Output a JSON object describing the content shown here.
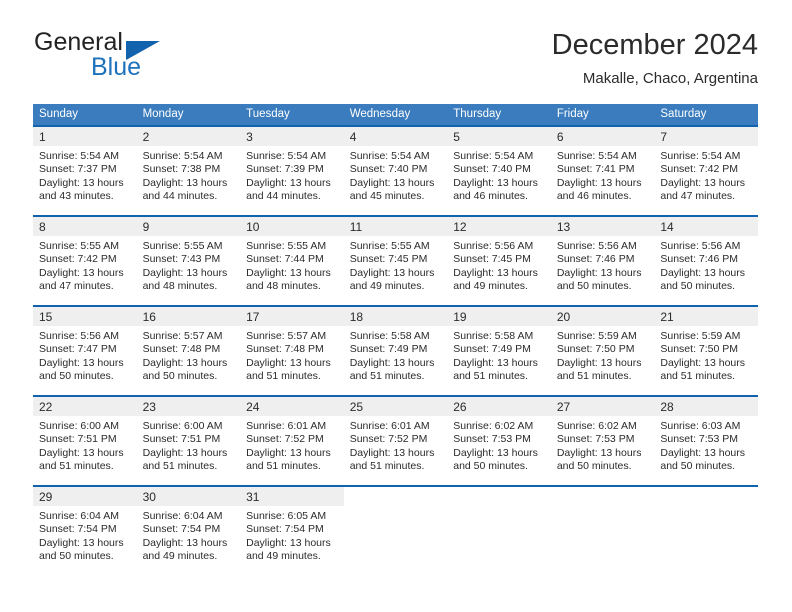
{
  "brand": {
    "name_top": "General",
    "name_bottom": "Blue",
    "accent_color": "#1263ad",
    "text_color": "#232323"
  },
  "header": {
    "title": "December 2024",
    "location": "Makalle, Chaco, Argentina"
  },
  "calendar": {
    "header_bg": "#3a7cbe",
    "row_divider_color": "#1263ad",
    "daynum_band_color": "#efefef",
    "weekday_headers": [
      "Sunday",
      "Monday",
      "Tuesday",
      "Wednesday",
      "Thursday",
      "Friday",
      "Saturday"
    ],
    "weeks": [
      [
        {
          "day": "1",
          "sunrise": "Sunrise: 5:54 AM",
          "sunset": "Sunset: 7:37 PM",
          "daylight_line1": "Daylight: 13 hours",
          "daylight_line2": "and 43 minutes."
        },
        {
          "day": "2",
          "sunrise": "Sunrise: 5:54 AM",
          "sunset": "Sunset: 7:38 PM",
          "daylight_line1": "Daylight: 13 hours",
          "daylight_line2": "and 44 minutes."
        },
        {
          "day": "3",
          "sunrise": "Sunrise: 5:54 AM",
          "sunset": "Sunset: 7:39 PM",
          "daylight_line1": "Daylight: 13 hours",
          "daylight_line2": "and 44 minutes."
        },
        {
          "day": "4",
          "sunrise": "Sunrise: 5:54 AM",
          "sunset": "Sunset: 7:40 PM",
          "daylight_line1": "Daylight: 13 hours",
          "daylight_line2": "and 45 minutes."
        },
        {
          "day": "5",
          "sunrise": "Sunrise: 5:54 AM",
          "sunset": "Sunset: 7:40 PM",
          "daylight_line1": "Daylight: 13 hours",
          "daylight_line2": "and 46 minutes."
        },
        {
          "day": "6",
          "sunrise": "Sunrise: 5:54 AM",
          "sunset": "Sunset: 7:41 PM",
          "daylight_line1": "Daylight: 13 hours",
          "daylight_line2": "and 46 minutes."
        },
        {
          "day": "7",
          "sunrise": "Sunrise: 5:54 AM",
          "sunset": "Sunset: 7:42 PM",
          "daylight_line1": "Daylight: 13 hours",
          "daylight_line2": "and 47 minutes."
        }
      ],
      [
        {
          "day": "8",
          "sunrise": "Sunrise: 5:55 AM",
          "sunset": "Sunset: 7:42 PM",
          "daylight_line1": "Daylight: 13 hours",
          "daylight_line2": "and 47 minutes."
        },
        {
          "day": "9",
          "sunrise": "Sunrise: 5:55 AM",
          "sunset": "Sunset: 7:43 PM",
          "daylight_line1": "Daylight: 13 hours",
          "daylight_line2": "and 48 minutes."
        },
        {
          "day": "10",
          "sunrise": "Sunrise: 5:55 AM",
          "sunset": "Sunset: 7:44 PM",
          "daylight_line1": "Daylight: 13 hours",
          "daylight_line2": "and 48 minutes."
        },
        {
          "day": "11",
          "sunrise": "Sunrise: 5:55 AM",
          "sunset": "Sunset: 7:45 PM",
          "daylight_line1": "Daylight: 13 hours",
          "daylight_line2": "and 49 minutes."
        },
        {
          "day": "12",
          "sunrise": "Sunrise: 5:56 AM",
          "sunset": "Sunset: 7:45 PM",
          "daylight_line1": "Daylight: 13 hours",
          "daylight_line2": "and 49 minutes."
        },
        {
          "day": "13",
          "sunrise": "Sunrise: 5:56 AM",
          "sunset": "Sunset: 7:46 PM",
          "daylight_line1": "Daylight: 13 hours",
          "daylight_line2": "and 50 minutes."
        },
        {
          "day": "14",
          "sunrise": "Sunrise: 5:56 AM",
          "sunset": "Sunset: 7:46 PM",
          "daylight_line1": "Daylight: 13 hours",
          "daylight_line2": "and 50 minutes."
        }
      ],
      [
        {
          "day": "15",
          "sunrise": "Sunrise: 5:56 AM",
          "sunset": "Sunset: 7:47 PM",
          "daylight_line1": "Daylight: 13 hours",
          "daylight_line2": "and 50 minutes."
        },
        {
          "day": "16",
          "sunrise": "Sunrise: 5:57 AM",
          "sunset": "Sunset: 7:48 PM",
          "daylight_line1": "Daylight: 13 hours",
          "daylight_line2": "and 50 minutes."
        },
        {
          "day": "17",
          "sunrise": "Sunrise: 5:57 AM",
          "sunset": "Sunset: 7:48 PM",
          "daylight_line1": "Daylight: 13 hours",
          "daylight_line2": "and 51 minutes."
        },
        {
          "day": "18",
          "sunrise": "Sunrise: 5:58 AM",
          "sunset": "Sunset: 7:49 PM",
          "daylight_line1": "Daylight: 13 hours",
          "daylight_line2": "and 51 minutes."
        },
        {
          "day": "19",
          "sunrise": "Sunrise: 5:58 AM",
          "sunset": "Sunset: 7:49 PM",
          "daylight_line1": "Daylight: 13 hours",
          "daylight_line2": "and 51 minutes."
        },
        {
          "day": "20",
          "sunrise": "Sunrise: 5:59 AM",
          "sunset": "Sunset: 7:50 PM",
          "daylight_line1": "Daylight: 13 hours",
          "daylight_line2": "and 51 minutes."
        },
        {
          "day": "21",
          "sunrise": "Sunrise: 5:59 AM",
          "sunset": "Sunset: 7:50 PM",
          "daylight_line1": "Daylight: 13 hours",
          "daylight_line2": "and 51 minutes."
        }
      ],
      [
        {
          "day": "22",
          "sunrise": "Sunrise: 6:00 AM",
          "sunset": "Sunset: 7:51 PM",
          "daylight_line1": "Daylight: 13 hours",
          "daylight_line2": "and 51 minutes."
        },
        {
          "day": "23",
          "sunrise": "Sunrise: 6:00 AM",
          "sunset": "Sunset: 7:51 PM",
          "daylight_line1": "Daylight: 13 hours",
          "daylight_line2": "and 51 minutes."
        },
        {
          "day": "24",
          "sunrise": "Sunrise: 6:01 AM",
          "sunset": "Sunset: 7:52 PM",
          "daylight_line1": "Daylight: 13 hours",
          "daylight_line2": "and 51 minutes."
        },
        {
          "day": "25",
          "sunrise": "Sunrise: 6:01 AM",
          "sunset": "Sunset: 7:52 PM",
          "daylight_line1": "Daylight: 13 hours",
          "daylight_line2": "and 51 minutes."
        },
        {
          "day": "26",
          "sunrise": "Sunrise: 6:02 AM",
          "sunset": "Sunset: 7:53 PM",
          "daylight_line1": "Daylight: 13 hours",
          "daylight_line2": "and 50 minutes."
        },
        {
          "day": "27",
          "sunrise": "Sunrise: 6:02 AM",
          "sunset": "Sunset: 7:53 PM",
          "daylight_line1": "Daylight: 13 hours",
          "daylight_line2": "and 50 minutes."
        },
        {
          "day": "28",
          "sunrise": "Sunrise: 6:03 AM",
          "sunset": "Sunset: 7:53 PM",
          "daylight_line1": "Daylight: 13 hours",
          "daylight_line2": "and 50 minutes."
        }
      ],
      [
        {
          "day": "29",
          "sunrise": "Sunrise: 6:04 AM",
          "sunset": "Sunset: 7:54 PM",
          "daylight_line1": "Daylight: 13 hours",
          "daylight_line2": "and 50 minutes."
        },
        {
          "day": "30",
          "sunrise": "Sunrise: 6:04 AM",
          "sunset": "Sunset: 7:54 PM",
          "daylight_line1": "Daylight: 13 hours",
          "daylight_line2": "and 49 minutes."
        },
        {
          "day": "31",
          "sunrise": "Sunrise: 6:05 AM",
          "sunset": "Sunset: 7:54 PM",
          "daylight_line1": "Daylight: 13 hours",
          "daylight_line2": "and 49 minutes."
        },
        {
          "day": "",
          "sunrise": "",
          "sunset": "",
          "daylight_line1": "",
          "daylight_line2": ""
        },
        {
          "day": "",
          "sunrise": "",
          "sunset": "",
          "daylight_line1": "",
          "daylight_line2": ""
        },
        {
          "day": "",
          "sunrise": "",
          "sunset": "",
          "daylight_line1": "",
          "daylight_line2": ""
        },
        {
          "day": "",
          "sunrise": "",
          "sunset": "",
          "daylight_line1": "",
          "daylight_line2": ""
        }
      ]
    ]
  }
}
